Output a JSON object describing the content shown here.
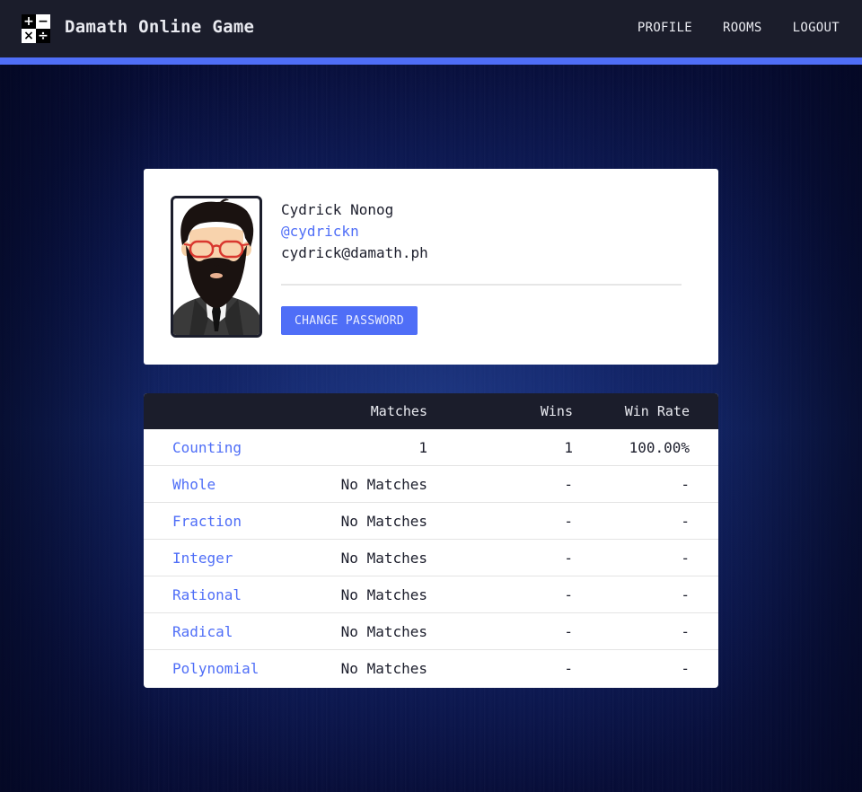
{
  "navbar": {
    "logo_icon": "calculator-operators-icon",
    "logo_glyphs": [
      "+",
      "−",
      "×",
      "÷"
    ],
    "title": "Damath Online Game",
    "links": [
      {
        "label": "PROFILE"
      },
      {
        "label": "ROOMS"
      },
      {
        "label": "LOGOUT"
      }
    ]
  },
  "colors": {
    "accent": "#4f6ef7",
    "navbar_bg": "#1b1d2b",
    "card_bg": "#ffffff",
    "page_bg": "#0d1850"
  },
  "profile": {
    "avatar_icon": "bearded-man-avatar-icon",
    "name": "Cydrick Nonog",
    "username": "@cydrickn",
    "email": "cydrick@damath.ph",
    "change_password_label": "CHANGE PASSWORD"
  },
  "stats": {
    "headers": {
      "mode": "",
      "matches": "Matches",
      "wins": "Wins",
      "win_rate": "Win Rate"
    },
    "rows": [
      {
        "mode": "Counting",
        "matches": "1",
        "wins": "1",
        "win_rate": "100.00%"
      },
      {
        "mode": "Whole",
        "matches": "No Matches",
        "wins": "-",
        "win_rate": "-"
      },
      {
        "mode": "Fraction",
        "matches": "No Matches",
        "wins": "-",
        "win_rate": "-"
      },
      {
        "mode": "Integer",
        "matches": "No Matches",
        "wins": "-",
        "win_rate": "-"
      },
      {
        "mode": "Rational",
        "matches": "No Matches",
        "wins": "-",
        "win_rate": "-"
      },
      {
        "mode": "Radical",
        "matches": "No Matches",
        "wins": "-",
        "win_rate": "-"
      },
      {
        "mode": "Polynomial",
        "matches": "No Matches",
        "wins": "-",
        "win_rate": "-"
      }
    ]
  }
}
